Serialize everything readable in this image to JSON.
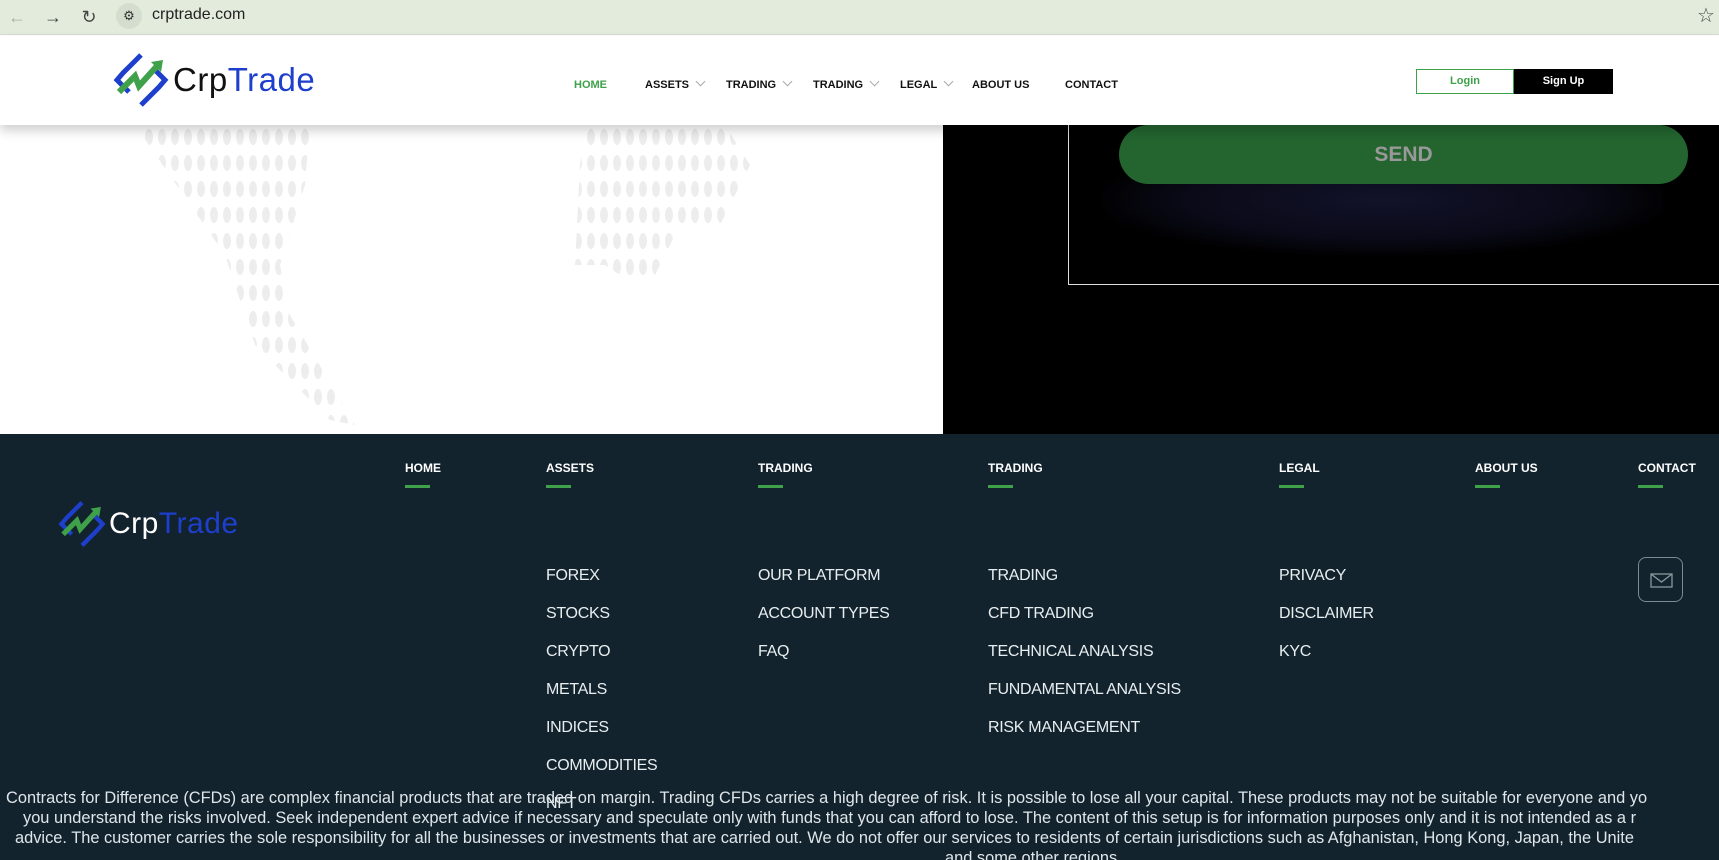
{
  "browser": {
    "url": "crptrade.com",
    "icons": [
      "back-arrow-icon",
      "forward-arrow-icon",
      "reload-icon",
      "site-settings-icon",
      "bookmark-star-icon"
    ]
  },
  "brand": {
    "name_part1": "Crp",
    "name_part2": "Trade",
    "colors": {
      "green": "#3fa14a",
      "blue": "#1d3fcc",
      "dark": "#12232d"
    }
  },
  "nav": {
    "items": [
      {
        "label": "HOME",
        "active": true
      },
      {
        "label": "ASSETS",
        "dropdown": true
      },
      {
        "label": "TRADING",
        "dropdown": true
      },
      {
        "label": "TRADING",
        "dropdown": true
      },
      {
        "label": "LEGAL",
        "dropdown": true
      },
      {
        "label": "ABOUT US"
      },
      {
        "label": "CONTACT"
      }
    ],
    "login": "Login",
    "signup": "Sign Up"
  },
  "form": {
    "send": "SEND"
  },
  "footer": {
    "columns": [
      {
        "title": "HOME",
        "items": []
      },
      {
        "title": "ASSETS",
        "items": [
          "FOREX",
          "STOCKS",
          "CRYPTO",
          "METALS",
          "INDICES",
          "COMMODITIES",
          "NFT"
        ]
      },
      {
        "title": "TRADING",
        "items": [
          "OUR PLATFORM",
          "ACCOUNT TYPES",
          "FAQ"
        ]
      },
      {
        "title": "TRADING",
        "items": [
          "TRADING",
          "CFD TRADING",
          "TECHNICAL ANALYSIS",
          "FUNDAMENTAL ANALYSIS",
          "RISK MANAGEMENT"
        ]
      },
      {
        "title": "LEGAL",
        "items": [
          "PRIVACY",
          "DISCLAIMER",
          "KYC"
        ]
      },
      {
        "title": "ABOUT US",
        "items": []
      },
      {
        "title": "CONTACT",
        "items": []
      }
    ],
    "disclaimer": [
      "Contracts for Difference (CFDs) are complex financial products that are traded on margin. Trading CFDs carries a high degree of risk. It is possible to lose all your capital. These products may not be suitable for everyone and yo",
      "you understand the risks involved. Seek independent expert advice if necessary and speculate only with funds that you can afford to lose. The content of this setup is for information purposes only and it is not intended as a r",
      "advice. The customer carries the sole responsibility for all the businesses or investments that are carried out. We do not offer our services to residents of certain jurisdictions such as Afghanistan, Hong Kong, Japan, the Unite",
      "and some other regions."
    ]
  }
}
